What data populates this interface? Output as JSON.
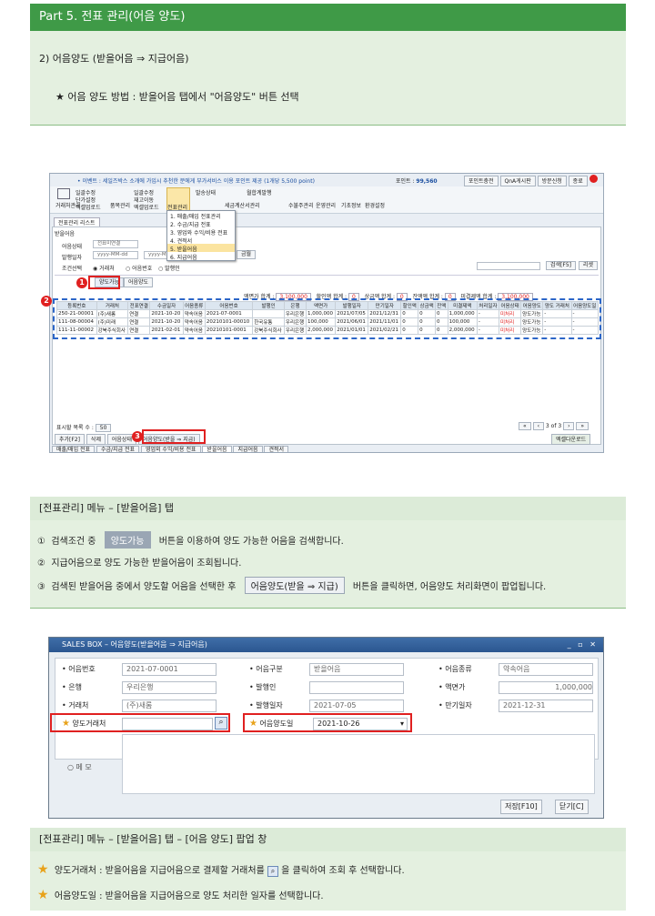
{
  "header": {
    "part_title": "Part 5. 전표 관리(어음 양도)",
    "section_title": "2) 어음양도 (받을어음 ⇒ 지급어음)",
    "method_line": "★ 어음 양도 방법 : 받을어음 탭에서 \"어음양도\" 버튼 선택"
  },
  "screen1": {
    "notice": "• 이벤트 : 세일즈박스 소개에 가입시 추천한 분에게 부가서비스 이용 포인트 제공 (1개당 5,500 point)",
    "points_label": "포인트 :",
    "points_value": "99,560",
    "top_buttons": [
      "포인트충전",
      "QnA게시판",
      "방문신청",
      "종료"
    ],
    "ribbon": [
      "거래처관리",
      "일괄수정",
      "단가설정",
      "엑셀업로드",
      "품목관리",
      "일괄수정",
      "재고이동",
      "엑셀업로드",
      "전표관리",
      "발송상태",
      "세금계산서관리",
      "월합계발행",
      "수불주관리",
      "운영관리",
      "기초정보",
      "환경설정"
    ],
    "menu": [
      "1. 매출/매입 전표관리",
      "2. 수금/지급 전표",
      "3. 영업와 수익/비용 전표",
      "4. 견적서",
      "5. 받을어음",
      "6. 지급어음"
    ],
    "tab": "전표관리 리스트",
    "subtab": "받을어음",
    "filter_labels": [
      "어음상태",
      "발행일자",
      "조건선택"
    ],
    "filter_status": "전표미연결",
    "date_placeholder": "yyyy-MM-dd",
    "radios": [
      "거래처",
      "어음번호",
      "발행인"
    ],
    "btn_search": "검색[F5]",
    "btn_reset": "리셋",
    "btn_today": "금월",
    "btn_transferable": "양도가능",
    "btn_transfer_small": "어음양도",
    "totals": [
      {
        "label": "액면가 합계 :",
        "value": "3,100,000"
      },
      {
        "label": "할인액 합계 :",
        "value": "0"
      },
      {
        "label": "상금액 합계 :",
        "value": "0"
      },
      {
        "label": "잔액액 합계 :",
        "value": "0"
      },
      {
        "label": "미결제액 합계 :",
        "value": "3,100,000"
      }
    ],
    "columns": [
      "등록번호",
      "거래처",
      "전표연결",
      "수금일자",
      "어음종류",
      "어음번호",
      "발행인",
      "은행",
      "액면가",
      "발행일자",
      "만기일자",
      "할인액",
      "상금액",
      "잔액",
      "미결제액",
      "처리일자",
      "어음상태",
      "어음양도",
      "양도 거래처",
      "어음양도일"
    ],
    "rows": [
      [
        "250-21-00001",
        "(주)새롬",
        "연결",
        "2021-10-20",
        "약속어음",
        "2021-07-0001",
        "",
        "우리은행",
        "1,000,000",
        "2021/07/05",
        "2021/12/31",
        "0",
        "0",
        "0",
        "1,000,000",
        "-",
        "미처리",
        "양도가능",
        "-",
        "-"
      ],
      [
        "111-08-00004",
        "(주)미래",
        "연결",
        "2021-10-20",
        "약속어음",
        "20210101-00010",
        "한국유통",
        "우리은행",
        "100,000",
        "2021/06/01",
        "2021/11/01",
        "0",
        "0",
        "0",
        "100,000",
        "-",
        "미처리",
        "양도가능",
        "-",
        "-"
      ],
      [
        "111-11-00002",
        "강북주식회사",
        "연결",
        "2021-02-01",
        "약속어음",
        "20210101-0001",
        "강북주식회사",
        "우리은행",
        "2,000,000",
        "2021/01/01",
        "2021/02/21",
        "0",
        "0",
        "0",
        "2,000,000",
        "-",
        "미처리",
        "양도가능",
        "-",
        "-"
      ]
    ],
    "display_count_label": "표시할 목록 수 :",
    "display_count": "50",
    "page": "3 of 3",
    "bottom_buttons": [
      "추가[F2]",
      "삭제",
      "어음상태",
      "어음양도(받을 ⇒ 지급)"
    ],
    "excel_button": "엑셀다운로드",
    "bottom_tabs": [
      "매출/매입 전표",
      "수금/지급 전표",
      "영업외 수익/비용 전표",
      "받을어음",
      "지급어음",
      "견적서"
    ],
    "badges": [
      "1",
      "2",
      "3"
    ]
  },
  "section2": {
    "title": "[전표관리] 메뉴 – [받을어음] 탭",
    "items": [
      {
        "num": "①",
        "pre": "검색조건 중",
        "btn": "양도가능",
        "post": "버튼을 이용하여 양도 가능한 어음을 검색합니다."
      },
      {
        "num": "②",
        "text": "지급어음으로 양도 가능한 받을어음이 조회됩니다."
      },
      {
        "num": "③",
        "pre": "검색된 받을어음 중에서 양도할 어음을 선택한 후",
        "btn": "어음양도(받을 ⇒ 지급)",
        "post": "버튼을 클릭하면, 어음양도 처리화면이 팝업됩니다."
      }
    ]
  },
  "popup": {
    "title": "SALES BOX – 어음양도(받을어음 ⇒ 지급어음)",
    "fields": [
      {
        "label": "어음번호",
        "value": "2021-07-0001"
      },
      {
        "label": "어음구분",
        "value": "받을어음"
      },
      {
        "label": "어음종류",
        "value": "약속어음"
      },
      {
        "label": "은행",
        "value": "우리은행"
      },
      {
        "label": "발행인",
        "value": ""
      },
      {
        "label": "액면가",
        "value": "1,000,000"
      },
      {
        "label": "거래처",
        "value": "(주)새롬"
      },
      {
        "label": "발행일자",
        "value": "2021-07-05"
      },
      {
        "label": "만기일자",
        "value": "2021-12-31"
      }
    ],
    "transfer_partner_label": "양도거래처",
    "transfer_date_label": "어음양도일",
    "transfer_date": "2021-10-26",
    "memo_label": "메 모",
    "save": "저장[F10]",
    "close": "닫기[C]"
  },
  "section3": {
    "title": "[전표관리] 메뉴 – [받을어음] 탭 – [어음 양도] 팝업 창",
    "line1": "양도거래처 : 받을어음을 지급어음으로  결제할 거래처를",
    "line1b": "을 클릭하여 조회 후 선택합니다.",
    "line2": "어음양도일 : 받을어음을 지급어음으로 양도 처리한 일자를 선택합니다."
  },
  "colors": {
    "green": "#3f9a47",
    "pale": "#e4f0e0",
    "red": "#e02020",
    "blue": "#2c66c8"
  }
}
